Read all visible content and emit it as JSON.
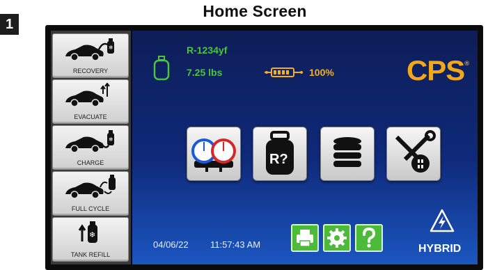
{
  "step_badge": "1",
  "title": "Home Screen",
  "sidebar": {
    "items": [
      {
        "label": "RECOVERY",
        "icon": "car-recovery-icon"
      },
      {
        "label": "EVACUATE",
        "icon": "car-evacuate-icon"
      },
      {
        "label": "CHARGE",
        "icon": "car-charge-icon"
      },
      {
        "label": "FULL CYCLE",
        "icon": "car-full-cycle-icon"
      },
      {
        "label": "TANK REFILL",
        "icon": "tank-refill-icon"
      }
    ]
  },
  "status": {
    "refrigerant": "R-1234yf",
    "weight": "7.25 lbs",
    "battery": "100%"
  },
  "brand": {
    "logo": "CPS",
    "mark": "®"
  },
  "tiles": [
    {
      "name": "gauges-tile",
      "icon": "manifold-gauges-icon"
    },
    {
      "name": "refrigerant-id-tile",
      "icon": "refrigerant-tank-question-icon",
      "text": "R?"
    },
    {
      "name": "database-tile",
      "icon": "database-icon"
    },
    {
      "name": "service-tools-tile",
      "icon": "wrench-screwdriver-icon"
    }
  ],
  "footer": {
    "date": "04/06/22",
    "time": "11:57:43 AM",
    "hybrid": "HYBRID"
  },
  "colors": {
    "screen_top": "#0d1d57",
    "screen_bottom": "#1b56c0",
    "status_green": "#4cc43c",
    "battery_amber": "#f2b01c",
    "logo_orange": "#f2a817",
    "button_green": "#4dbb3a"
  }
}
